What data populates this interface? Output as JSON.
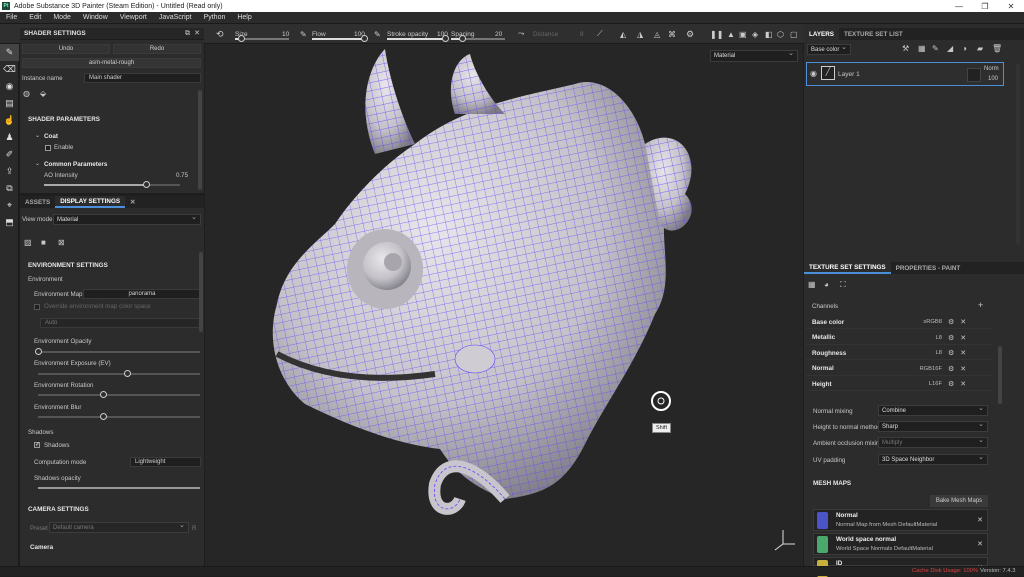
{
  "window": {
    "title": "Adobe Substance 3D Painter (Steam Edition) - Untitled (Read only)",
    "app_icon": "Pt"
  },
  "menu": [
    "File",
    "Edit",
    "Mode",
    "Window",
    "Viewport",
    "JavaScript",
    "Python",
    "Help"
  ],
  "toolbar": {
    "size_label": "Size",
    "size_value": "10",
    "size_fraction": 0.12,
    "flow_label": "Flow",
    "flow_value": "100",
    "flow_fraction": 1.0,
    "stroke_opacity_label": "Stroke opacity",
    "stroke_opacity_value": "100",
    "stroke_opacity_fraction": 1.0,
    "spacing_label": "Spacing",
    "spacing_value": "20",
    "spacing_fraction": 0.2,
    "distance_label": "Distance",
    "distance_value": "8"
  },
  "shader_settings": {
    "title": "SHADER SETTINGS",
    "undo": "Undo",
    "redo": "Redo",
    "shader_name": "asm-metal-rough",
    "instance_label": "Instance name",
    "instance_value": "Main shader",
    "params_title": "SHADER PARAMETERS",
    "coat": "Coat",
    "enable": "Enable",
    "common": "Common Parameters",
    "ao_label": "AO Intensity",
    "ao_value": "0.75",
    "ao_fraction": 0.75
  },
  "display_settings": {
    "tab_assets": "ASSETS",
    "tab_display": "DISPLAY SETTINGS",
    "view_mode_label": "View mode",
    "view_mode_value": "Material",
    "env_title": "ENVIRONMENT SETTINGS",
    "environment": "Environment",
    "env_map_label": "Environment Map",
    "env_map_value": "panorama",
    "override_label": "Override environment map color space",
    "auto": "Auto",
    "env_opacity": "Environment Opacity",
    "env_opacity_fraction": 0.0,
    "env_exposure": "Environment Exposure (EV)",
    "env_exposure_fraction": 0.55,
    "env_rotation": "Environment Rotation",
    "env_rotation_fraction": 0.4,
    "env_blur": "Environment Blur",
    "env_blur_fraction": 0.4,
    "shadows": "Shadows",
    "shadows_cb": "Shadows",
    "computation_label": "Computation mode",
    "computation_value": "Lightweight",
    "shadows_opacity": "Shadows opacity",
    "camera_title": "CAMERA SETTINGS",
    "preset_label": "Preset",
    "preset_value": "Default camera",
    "camera": "Camera"
  },
  "viewport": {
    "mode": "Material",
    "hint": "Shift"
  },
  "layers": {
    "tab_layers": "LAYERS",
    "tab_texture_set_list": "TEXTURE SET LIST",
    "channel": "Base color",
    "layer_name": "Layer 1",
    "blend": "Norm",
    "opacity": "100"
  },
  "texture_set": {
    "tab_settings": "TEXTURE SET SETTINGS",
    "tab_properties": "PROPERTIES - PAINT",
    "channels_label": "Channels",
    "channels": [
      {
        "name": "Base color",
        "format": "sRGB8"
      },
      {
        "name": "Metallic",
        "format": "L8"
      },
      {
        "name": "Roughness",
        "format": "L8"
      },
      {
        "name": "Normal",
        "format": "RGB16F"
      },
      {
        "name": "Height",
        "format": "L16F"
      }
    ],
    "normal_mixing_label": "Normal mixing",
    "normal_mixing_value": "Combine",
    "h2n_label": "Height to normal method",
    "h2n_value": "Sharp",
    "ao_mixing_label": "Ambient occlusion mixing",
    "ao_mixing_value": "Multiply",
    "uv_padding_label": "UV padding",
    "uv_padding_value": "3D Space Neighbor",
    "mesh_maps_title": "MESH MAPS",
    "bake_button": "Bake Mesh Maps",
    "mesh_maps": [
      {
        "name": "Normal",
        "desc": "Normal Map from Mesh DefaultMaterial",
        "color": "#4a55c8"
      },
      {
        "name": "World space normal",
        "desc": "World Space Normals DefaultMaterial",
        "color": "#4aa86a"
      },
      {
        "name": "ID",
        "desc": "",
        "color": "#c8b03a"
      }
    ]
  },
  "status": {
    "cache": "Cache Disk Usage: 100%",
    "version": "Version: 7.4.3"
  },
  "colors": {
    "wire": "#6a3fff",
    "clay": "#cfcfd2",
    "accent": "#4a8fd8"
  }
}
